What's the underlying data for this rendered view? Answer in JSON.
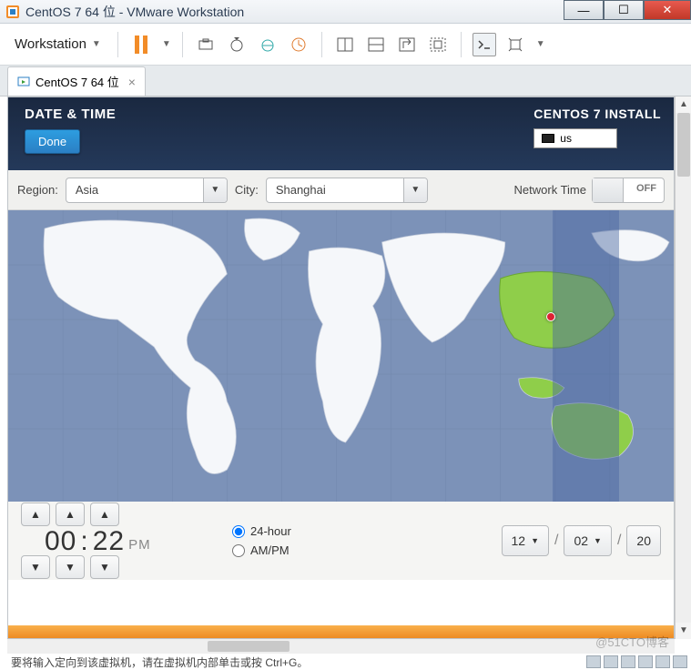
{
  "window": {
    "title": "CentOS 7 64 位 - VMware Workstation",
    "min_label": "—",
    "max_label": "☐",
    "close_label": "✕"
  },
  "toolbar": {
    "workstation_label": "Workstation"
  },
  "tab": {
    "label": "CentOS 7 64 位"
  },
  "installer": {
    "page_title": "DATE & TIME",
    "done_label": "Done",
    "product_title": "CENTOS 7 INSTALL",
    "keyboard_layout": "us",
    "region_label": "Region:",
    "region_value": "Asia",
    "city_label": "City:",
    "city_value": "Shanghai",
    "network_time_label": "Network Time",
    "network_time_state": "OFF",
    "time": {
      "hours": "00",
      "minutes": "22",
      "ampm": "PM",
      "format24_label": "24-hour",
      "format12_label": "AM/PM",
      "format_selected": "24"
    },
    "date": {
      "day": "12",
      "month": "02",
      "year": "20"
    }
  },
  "statusbar": {
    "hint": "要将输入定向到该虚拟机，请在虚拟机内部单击或按 Ctrl+G。"
  },
  "watermark": "@51CTO博客"
}
